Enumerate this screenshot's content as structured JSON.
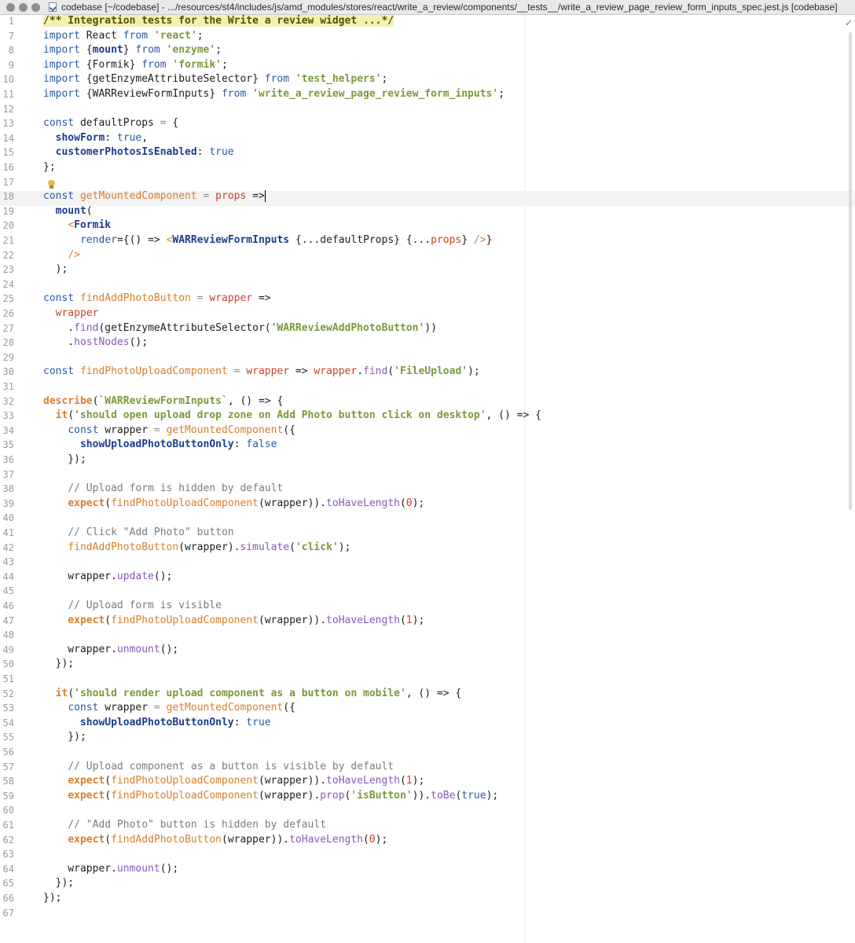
{
  "window": {
    "title": "codebase [~/codebase] - .../resources/st4/includes/js/amd_modules/stores/react/write_a_review/components/__tests__/write_a_review_page_review_form_inputs_spec.jest.js [codebase]"
  },
  "editor": {
    "lines": [
      {
        "n": "1",
        "t": [
          [
            "/** Integration tests for the Write a review widget ...*/",
            "hdr"
          ]
        ]
      },
      {
        "n": "7",
        "t": [
          [
            "import",
            "kw"
          ],
          [
            " React ",
            ""
          ],
          [
            "from",
            "kw"
          ],
          [
            " ",
            ""
          ],
          [
            "'react'",
            "str"
          ],
          [
            ";",
            ""
          ]
        ]
      },
      {
        "n": "8",
        "t": [
          [
            "import",
            "kw"
          ],
          [
            " {",
            ""
          ],
          [
            "mount",
            "attr"
          ],
          [
            "} ",
            ""
          ],
          [
            "from",
            "kw"
          ],
          [
            " ",
            ""
          ],
          [
            "'enzyme'",
            "str"
          ],
          [
            ";",
            ""
          ]
        ]
      },
      {
        "n": "9",
        "t": [
          [
            "import",
            "kw"
          ],
          [
            " {Formik} ",
            ""
          ],
          [
            "from",
            "kw"
          ],
          [
            " ",
            ""
          ],
          [
            "'formik'",
            "str"
          ],
          [
            ";",
            ""
          ]
        ]
      },
      {
        "n": "10",
        "t": [
          [
            "import",
            "kw"
          ],
          [
            " {getEnzymeAttributeSelector} ",
            ""
          ],
          [
            "from",
            "kw"
          ],
          [
            " ",
            ""
          ],
          [
            "'test_helpers'",
            "str"
          ],
          [
            ";",
            ""
          ]
        ]
      },
      {
        "n": "11",
        "t": [
          [
            "import",
            "kw"
          ],
          [
            " {WARReviewFormInputs} ",
            ""
          ],
          [
            "from",
            "kw"
          ],
          [
            " ",
            ""
          ],
          [
            "'write_a_review_page_review_form_inputs'",
            "str"
          ],
          [
            ";",
            ""
          ]
        ]
      },
      {
        "n": "12",
        "t": []
      },
      {
        "n": "13",
        "t": [
          [
            "const",
            "kw"
          ],
          [
            " defaultProps ",
            ""
          ],
          [
            "=",
            "op"
          ],
          [
            " {",
            ""
          ]
        ]
      },
      {
        "n": "14",
        "t": [
          [
            "  ",
            ""
          ],
          [
            "showForm",
            "attr"
          ],
          [
            ": ",
            ""
          ],
          [
            "true",
            "kw"
          ],
          [
            ",",
            ""
          ]
        ]
      },
      {
        "n": "15",
        "t": [
          [
            "  ",
            ""
          ],
          [
            "customerPhotosIsEnabled",
            "attr"
          ],
          [
            ": ",
            ""
          ],
          [
            "true",
            "kw"
          ]
        ]
      },
      {
        "n": "16",
        "t": [
          [
            "};",
            ""
          ]
        ]
      },
      {
        "n": "17",
        "t": []
      },
      {
        "n": "18",
        "t": [
          [
            "const",
            "kw"
          ],
          [
            " ",
            ""
          ],
          [
            "getMountedComponent",
            "fn"
          ],
          [
            " ",
            ""
          ],
          [
            "=",
            "op"
          ],
          [
            " ",
            ""
          ],
          [
            "props",
            "var"
          ],
          [
            " =>",
            ""
          ]
        ],
        "caret": true
      },
      {
        "n": "19",
        "t": [
          [
            "  ",
            ""
          ],
          [
            "mount",
            "attr"
          ],
          [
            "(",
            ""
          ]
        ]
      },
      {
        "n": "20",
        "t": [
          [
            "    ",
            ""
          ],
          [
            "<",
            "tag"
          ],
          [
            "Formik",
            "attr"
          ]
        ]
      },
      {
        "n": "21",
        "t": [
          [
            "      ",
            ""
          ],
          [
            "render",
            "kw"
          ],
          [
            "={() => ",
            ""
          ],
          [
            "<",
            "tag"
          ],
          [
            "WARReviewFormInputs",
            "attr"
          ],
          [
            " {...defaultProps} {...",
            ""
          ],
          [
            "props",
            "var"
          ],
          [
            "} ",
            ""
          ],
          [
            "/>",
            "tag"
          ],
          [
            "}",
            ""
          ]
        ]
      },
      {
        "n": "22",
        "t": [
          [
            "    ",
            ""
          ],
          [
            "/>",
            "tag"
          ]
        ]
      },
      {
        "n": "23",
        "t": [
          [
            "  );",
            ""
          ]
        ]
      },
      {
        "n": "24",
        "t": []
      },
      {
        "n": "25",
        "t": [
          [
            "const",
            "kw"
          ],
          [
            " ",
            ""
          ],
          [
            "findAddPhotoButton",
            "fn"
          ],
          [
            " ",
            ""
          ],
          [
            "=",
            "op"
          ],
          [
            " ",
            ""
          ],
          [
            "wrapper",
            "var"
          ],
          [
            " =>",
            ""
          ]
        ]
      },
      {
        "n": "26",
        "t": [
          [
            "  ",
            ""
          ],
          [
            "wrapper",
            "var"
          ]
        ]
      },
      {
        "n": "27",
        "t": [
          [
            "    .",
            ""
          ],
          [
            "find",
            "method"
          ],
          [
            "(getEnzymeAttributeSelector(",
            ""
          ],
          [
            "'WARReviewAddPhotoButton'",
            "str"
          ],
          [
            "))",
            ""
          ]
        ]
      },
      {
        "n": "28",
        "t": [
          [
            "    .",
            ""
          ],
          [
            "hostNodes",
            "method"
          ],
          [
            "();",
            ""
          ]
        ]
      },
      {
        "n": "29",
        "t": []
      },
      {
        "n": "30",
        "t": [
          [
            "const",
            "kw"
          ],
          [
            " ",
            ""
          ],
          [
            "findPhotoUploadComponent",
            "fn"
          ],
          [
            " ",
            ""
          ],
          [
            "=",
            "op"
          ],
          [
            " ",
            ""
          ],
          [
            "wrapper",
            "var"
          ],
          [
            " => ",
            ""
          ],
          [
            "wrapper",
            "var"
          ],
          [
            ".",
            ""
          ],
          [
            "find",
            "method"
          ],
          [
            "(",
            ""
          ],
          [
            "'FileUpload'",
            "str"
          ],
          [
            ");",
            ""
          ]
        ]
      },
      {
        "n": "31",
        "t": []
      },
      {
        "n": "32",
        "t": [
          [
            "describe",
            "exp"
          ],
          [
            "(",
            ""
          ],
          [
            "`WARReviewFormInputs`",
            "str"
          ],
          [
            ", () => {",
            ""
          ]
        ]
      },
      {
        "n": "33",
        "t": [
          [
            "  ",
            ""
          ],
          [
            "it",
            "exp"
          ],
          [
            "(",
            ""
          ],
          [
            "'should open upload drop zone on Add Photo button click on desktop'",
            "str"
          ],
          [
            ", () => {",
            ""
          ]
        ]
      },
      {
        "n": "34",
        "t": [
          [
            "    ",
            ""
          ],
          [
            "const",
            "kw"
          ],
          [
            " wrapper ",
            ""
          ],
          [
            "=",
            "op"
          ],
          [
            " ",
            ""
          ],
          [
            "getMountedComponent",
            "fn"
          ],
          [
            "({",
            ""
          ]
        ]
      },
      {
        "n": "35",
        "t": [
          [
            "      ",
            ""
          ],
          [
            "showUploadPhotoButtonOnly",
            "attr"
          ],
          [
            ": ",
            ""
          ],
          [
            "false",
            "kw"
          ]
        ]
      },
      {
        "n": "36",
        "t": [
          [
            "    });",
            ""
          ]
        ]
      },
      {
        "n": "37",
        "t": []
      },
      {
        "n": "38",
        "t": [
          [
            "    ",
            ""
          ],
          [
            "// Upload form is hidden by default",
            "cmt"
          ]
        ]
      },
      {
        "n": "39",
        "t": [
          [
            "    ",
            ""
          ],
          [
            "expect",
            "exp"
          ],
          [
            "(",
            ""
          ],
          [
            "findPhotoUploadComponent",
            "fn"
          ],
          [
            "(wrapper)).",
            ""
          ],
          [
            "toHaveLength",
            "method"
          ],
          [
            "(",
            ""
          ],
          [
            "0",
            "num"
          ],
          [
            ");",
            ""
          ]
        ]
      },
      {
        "n": "40",
        "t": []
      },
      {
        "n": "41",
        "t": [
          [
            "    ",
            ""
          ],
          [
            "// Click \"Add Photo\" button",
            "cmt"
          ]
        ]
      },
      {
        "n": "42",
        "t": [
          [
            "    ",
            ""
          ],
          [
            "findAddPhotoButton",
            "fn"
          ],
          [
            "(wrapper).",
            ""
          ],
          [
            "simulate",
            "method"
          ],
          [
            "(",
            ""
          ],
          [
            "'click'",
            "str"
          ],
          [
            ");",
            ""
          ]
        ]
      },
      {
        "n": "43",
        "t": []
      },
      {
        "n": "44",
        "t": [
          [
            "    wrapper.",
            ""
          ],
          [
            "update",
            "method"
          ],
          [
            "();",
            ""
          ]
        ]
      },
      {
        "n": "45",
        "t": []
      },
      {
        "n": "46",
        "t": [
          [
            "    ",
            ""
          ],
          [
            "// Upload form is visible",
            "cmt"
          ]
        ]
      },
      {
        "n": "47",
        "t": [
          [
            "    ",
            ""
          ],
          [
            "expect",
            "exp"
          ],
          [
            "(",
            ""
          ],
          [
            "findPhotoUploadComponent",
            "fn"
          ],
          [
            "(wrapper)).",
            ""
          ],
          [
            "toHaveLength",
            "method"
          ],
          [
            "(",
            ""
          ],
          [
            "1",
            "num"
          ],
          [
            ");",
            ""
          ]
        ]
      },
      {
        "n": "48",
        "t": []
      },
      {
        "n": "49",
        "t": [
          [
            "    wrapper.",
            ""
          ],
          [
            "unmount",
            "method"
          ],
          [
            "();",
            ""
          ]
        ]
      },
      {
        "n": "50",
        "t": [
          [
            "  });",
            ""
          ]
        ]
      },
      {
        "n": "51",
        "t": []
      },
      {
        "n": "52",
        "t": [
          [
            "  ",
            ""
          ],
          [
            "it",
            "exp"
          ],
          [
            "(",
            ""
          ],
          [
            "'should render upload component as a button on mobile'",
            "str"
          ],
          [
            ", () => {",
            ""
          ]
        ]
      },
      {
        "n": "53",
        "t": [
          [
            "    ",
            ""
          ],
          [
            "const",
            "kw"
          ],
          [
            " wrapper ",
            ""
          ],
          [
            "=",
            "op"
          ],
          [
            " ",
            ""
          ],
          [
            "getMountedComponent",
            "fn"
          ],
          [
            "({",
            ""
          ]
        ]
      },
      {
        "n": "54",
        "t": [
          [
            "      ",
            ""
          ],
          [
            "showUploadPhotoButtonOnly",
            "attr"
          ],
          [
            ": ",
            ""
          ],
          [
            "true",
            "kw"
          ]
        ]
      },
      {
        "n": "55",
        "t": [
          [
            "    });",
            ""
          ]
        ]
      },
      {
        "n": "56",
        "t": []
      },
      {
        "n": "57",
        "t": [
          [
            "    ",
            ""
          ],
          [
            "// Upload component as a button is visible by default",
            "cmt"
          ]
        ]
      },
      {
        "n": "58",
        "t": [
          [
            "    ",
            ""
          ],
          [
            "expect",
            "exp"
          ],
          [
            "(",
            ""
          ],
          [
            "findPhotoUploadComponent",
            "fn"
          ],
          [
            "(wrapper)).",
            ""
          ],
          [
            "toHaveLength",
            "method"
          ],
          [
            "(",
            ""
          ],
          [
            "1",
            "num"
          ],
          [
            ");",
            ""
          ]
        ]
      },
      {
        "n": "59",
        "t": [
          [
            "    ",
            ""
          ],
          [
            "expect",
            "exp"
          ],
          [
            "(",
            ""
          ],
          [
            "findPhotoUploadComponent",
            "fn"
          ],
          [
            "(wrapper).",
            ""
          ],
          [
            "prop",
            "method"
          ],
          [
            "(",
            ""
          ],
          [
            "'isButton'",
            "str"
          ],
          [
            ")).",
            ""
          ],
          [
            "toBe",
            "method"
          ],
          [
            "(",
            ""
          ],
          [
            "true",
            "kw"
          ],
          [
            ");",
            ""
          ]
        ]
      },
      {
        "n": "60",
        "t": []
      },
      {
        "n": "61",
        "t": [
          [
            "    ",
            ""
          ],
          [
            "// \"Add Photo\" button is hidden by default",
            "cmt"
          ]
        ]
      },
      {
        "n": "62",
        "t": [
          [
            "    ",
            ""
          ],
          [
            "expect",
            "exp"
          ],
          [
            "(",
            ""
          ],
          [
            "findAddPhotoButton",
            "fn"
          ],
          [
            "(wrapper)).",
            ""
          ],
          [
            "toHaveLength",
            "method"
          ],
          [
            "(",
            ""
          ],
          [
            "0",
            "num"
          ],
          [
            ");",
            ""
          ]
        ]
      },
      {
        "n": "63",
        "t": []
      },
      {
        "n": "64",
        "t": [
          [
            "    wrapper.",
            ""
          ],
          [
            "unmount",
            "method"
          ],
          [
            "();",
            ""
          ]
        ]
      },
      {
        "n": "65",
        "t": [
          [
            "  });",
            ""
          ]
        ]
      },
      {
        "n": "66",
        "t": [
          [
            "});",
            ""
          ]
        ]
      },
      {
        "n": "67",
        "t": []
      }
    ]
  },
  "icons": {
    "inspection_status": "check-icon",
    "intention": "lightbulb-icon"
  },
  "colors": {
    "keyword": "#2859a8",
    "string": "#7a9a39",
    "function": "#d97e2a",
    "variable": "#c6432a",
    "comment": "#7b7b7b",
    "method": "#8a58b8",
    "header_highlight": "#f4efb3"
  }
}
